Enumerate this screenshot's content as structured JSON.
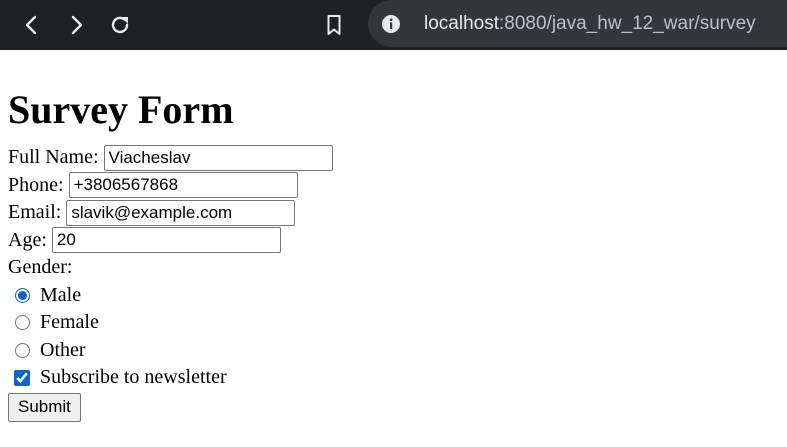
{
  "browser": {
    "url_host": "localhost",
    "url_path": ":8080/java_hw_12_war/survey"
  },
  "page": {
    "title": "Survey Form",
    "fields": {
      "name": {
        "label": "Full Name:",
        "value": "Viacheslav"
      },
      "phone": {
        "label": "Phone:",
        "value": "+3806567868"
      },
      "email": {
        "label": "Email:",
        "value": "slavik@example.com"
      },
      "age": {
        "label": "Age:",
        "value": "20"
      }
    },
    "gender": {
      "label": "Gender:",
      "options": [
        "Male",
        "Female",
        "Other"
      ],
      "selected": "Male"
    },
    "newsletter": {
      "label": "Subscribe to newsletter",
      "checked": true
    },
    "submit_label": "Submit"
  },
  "colors": {
    "toolbar_bg": "#202124",
    "omnibox_bg": "#35363a",
    "accent": "#0b63ce"
  },
  "icons": [
    "back-arrow-icon",
    "forward-arrow-icon",
    "reload-icon",
    "bookmark-icon",
    "info-icon"
  ]
}
